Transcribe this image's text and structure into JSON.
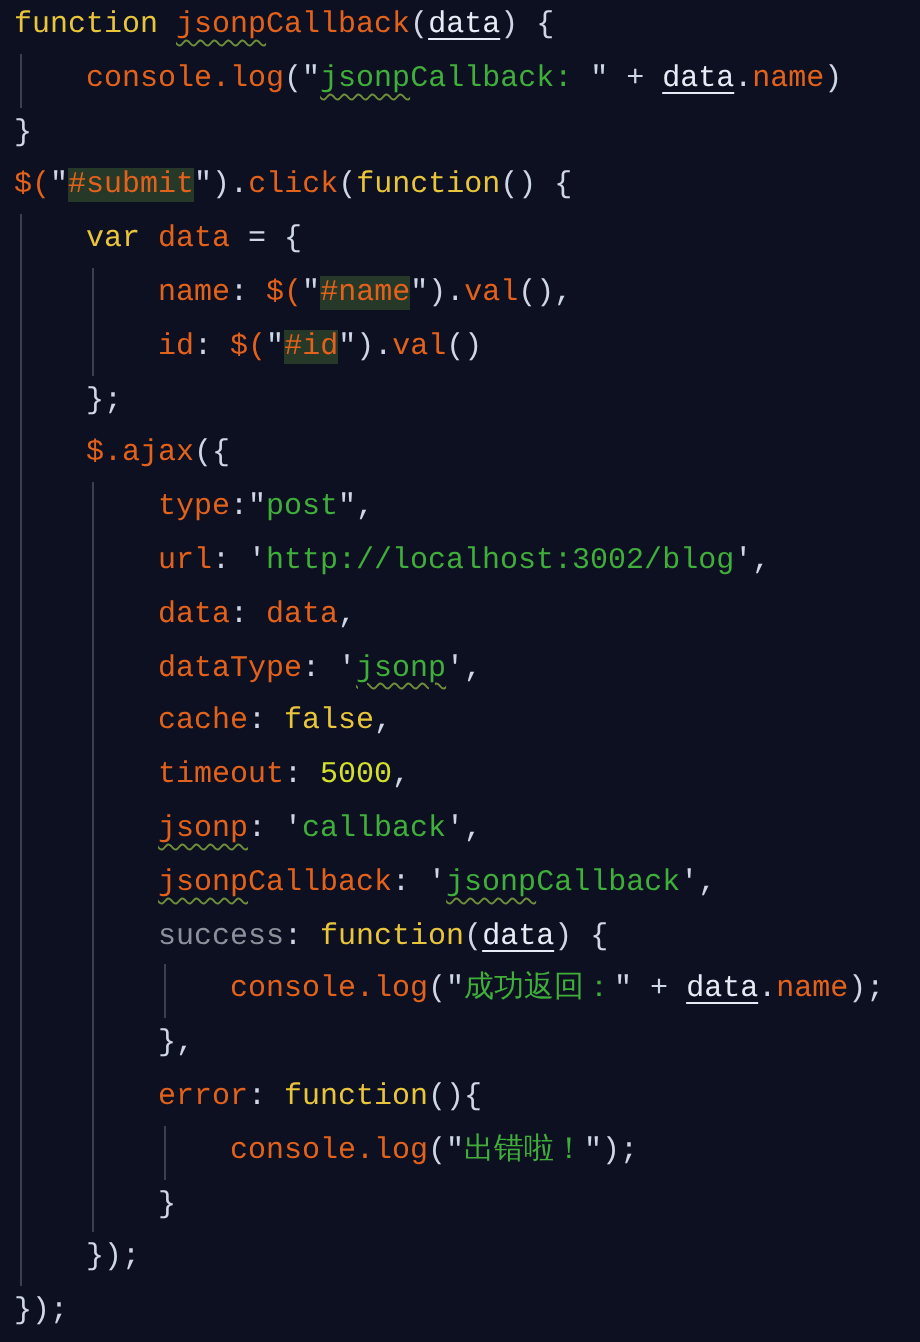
{
  "editor": {
    "lines": [
      {
        "tokens": [
          {
            "t": "function ",
            "kind": "keyword"
          },
          {
            "t": "jsonp",
            "kind": "name_squiggle"
          },
          {
            "t": "Callback",
            "kind": "name"
          },
          {
            "t": "(",
            "kind": "punct"
          },
          {
            "t": "data",
            "kind": "param"
          },
          {
            "t": ") {",
            "kind": "punct"
          }
        ],
        "children": [
          {
            "tokens": [
              {
                "t": "console.log",
                "kind": "name"
              },
              {
                "t": "(\"",
                "kind": "punct"
              },
              {
                "t": "jsonp",
                "kind": "string_squiggle"
              },
              {
                "t": "Callback: ",
                "kind": "string"
              },
              {
                "t": "\" + ",
                "kind": "punct"
              },
              {
                "t": "data",
                "kind": "param"
              },
              {
                "t": ".",
                "kind": "punct"
              },
              {
                "t": "name",
                "kind": "name"
              },
              {
                "t": ")",
                "kind": "punct"
              }
            ]
          }
        ]
      },
      {
        "tokens": [
          {
            "t": "}",
            "kind": "punct"
          }
        ]
      },
      {
        "tokens": [
          {
            "t": "$(",
            "kind": "name"
          },
          {
            "t": "\"",
            "kind": "punct"
          },
          {
            "t": "#submit",
            "kind": "name_match"
          },
          {
            "t": "\").",
            "kind": "punct"
          },
          {
            "t": "click",
            "kind": "name"
          },
          {
            "t": "(",
            "kind": "punct"
          },
          {
            "t": "function",
            "kind": "keyword"
          },
          {
            "t": "() {",
            "kind": "punct"
          }
        ],
        "children": [
          {
            "tokens": [
              {
                "t": "var ",
                "kind": "keyword"
              },
              {
                "t": "data",
                "kind": "name"
              },
              {
                "t": " = {",
                "kind": "punct"
              }
            ],
            "children": [
              {
                "tokens": [
                  {
                    "t": "name",
                    "kind": "name"
                  },
                  {
                    "t": ": ",
                    "kind": "punct"
                  },
                  {
                    "t": "$(",
                    "kind": "name"
                  },
                  {
                    "t": "\"",
                    "kind": "punct"
                  },
                  {
                    "t": "#name",
                    "kind": "name_match"
                  },
                  {
                    "t": "\").",
                    "kind": "punct"
                  },
                  {
                    "t": "val",
                    "kind": "name"
                  },
                  {
                    "t": "(),",
                    "kind": "punct"
                  }
                ]
              },
              {
                "tokens": [
                  {
                    "t": "id",
                    "kind": "name"
                  },
                  {
                    "t": ": ",
                    "kind": "punct"
                  },
                  {
                    "t": "$(",
                    "kind": "name"
                  },
                  {
                    "t": "\"",
                    "kind": "punct"
                  },
                  {
                    "t": "#id",
                    "kind": "name_match"
                  },
                  {
                    "t": "\").",
                    "kind": "punct"
                  },
                  {
                    "t": "val",
                    "kind": "name"
                  },
                  {
                    "t": "()",
                    "kind": "punct"
                  }
                ]
              }
            ]
          },
          {
            "tokens": [
              {
                "t": "};",
                "kind": "punct"
              }
            ]
          },
          {
            "tokens": [
              {
                "t": "$.ajax",
                "kind": "name"
              },
              {
                "t": "({",
                "kind": "punct"
              }
            ],
            "children": [
              {
                "tokens": [
                  {
                    "t": "type",
                    "kind": "name"
                  },
                  {
                    "t": ":\"",
                    "kind": "punct"
                  },
                  {
                    "t": "post",
                    "kind": "string"
                  },
                  {
                    "t": "\",",
                    "kind": "punct"
                  }
                ]
              },
              {
                "tokens": [
                  {
                    "t": "url",
                    "kind": "name"
                  },
                  {
                    "t": ": '",
                    "kind": "punct"
                  },
                  {
                    "t": "http://localhost:3002/blog",
                    "kind": "string"
                  },
                  {
                    "t": "',",
                    "kind": "punct"
                  }
                ]
              },
              {
                "tokens": [
                  {
                    "t": "data",
                    "kind": "name"
                  },
                  {
                    "t": ": ",
                    "kind": "punct"
                  },
                  {
                    "t": "data",
                    "kind": "name"
                  },
                  {
                    "t": ",",
                    "kind": "punct"
                  }
                ]
              },
              {
                "tokens": [
                  {
                    "t": "dataType",
                    "kind": "name"
                  },
                  {
                    "t": ": '",
                    "kind": "punct"
                  },
                  {
                    "t": "jsonp",
                    "kind": "string_squiggle"
                  },
                  {
                    "t": "',",
                    "kind": "punct"
                  }
                ]
              },
              {
                "tokens": [
                  {
                    "t": "cache",
                    "kind": "name"
                  },
                  {
                    "t": ": ",
                    "kind": "punct"
                  },
                  {
                    "t": "false",
                    "kind": "keyword"
                  },
                  {
                    "t": ",",
                    "kind": "punct"
                  }
                ]
              },
              {
                "tokens": [
                  {
                    "t": "timeout",
                    "kind": "name"
                  },
                  {
                    "t": ": ",
                    "kind": "punct"
                  },
                  {
                    "t": "5000",
                    "kind": "number"
                  },
                  {
                    "t": ",",
                    "kind": "punct"
                  }
                ]
              },
              {
                "tokens": [
                  {
                    "t": "jsonp",
                    "kind": "name_squiggle"
                  },
                  {
                    "t": ": '",
                    "kind": "punct"
                  },
                  {
                    "t": "callback",
                    "kind": "string"
                  },
                  {
                    "t": "',",
                    "kind": "punct"
                  }
                ]
              },
              {
                "tokens": [
                  {
                    "t": "jsonp",
                    "kind": "name_squiggle"
                  },
                  {
                    "t": "Callback",
                    "kind": "name"
                  },
                  {
                    "t": ": '",
                    "kind": "punct"
                  },
                  {
                    "t": "jsonp",
                    "kind": "string_squiggle"
                  },
                  {
                    "t": "Callback",
                    "kind": "string"
                  },
                  {
                    "t": "',",
                    "kind": "punct"
                  }
                ]
              },
              {
                "tokens": [
                  {
                    "t": "success",
                    "kind": "muted"
                  },
                  {
                    "t": ": ",
                    "kind": "punct"
                  },
                  {
                    "t": "function",
                    "kind": "keyword"
                  },
                  {
                    "t": "(",
                    "kind": "punct"
                  },
                  {
                    "t": "data",
                    "kind": "param"
                  },
                  {
                    "t": ") {",
                    "kind": "punct"
                  }
                ],
                "children": [
                  {
                    "tokens": [
                      {
                        "t": "console.log",
                        "kind": "name"
                      },
                      {
                        "t": "(\"",
                        "kind": "punct"
                      },
                      {
                        "t": "成功返回：",
                        "kind": "string"
                      },
                      {
                        "t": "\" + ",
                        "kind": "punct"
                      },
                      {
                        "t": "data",
                        "kind": "param"
                      },
                      {
                        "t": ".",
                        "kind": "punct"
                      },
                      {
                        "t": "name",
                        "kind": "name"
                      },
                      {
                        "t": ");",
                        "kind": "punct"
                      }
                    ]
                  }
                ]
              },
              {
                "tokens": [
                  {
                    "t": "},",
                    "kind": "punct"
                  }
                ]
              },
              {
                "tokens": [
                  {
                    "t": "error",
                    "kind": "name"
                  },
                  {
                    "t": ": ",
                    "kind": "punct"
                  },
                  {
                    "t": "function",
                    "kind": "keyword"
                  },
                  {
                    "t": "(){",
                    "kind": "punct"
                  }
                ],
                "children": [
                  {
                    "tokens": [
                      {
                        "t": "console.log",
                        "kind": "name"
                      },
                      {
                        "t": "(\"",
                        "kind": "punct"
                      },
                      {
                        "t": "出错啦！",
                        "kind": "string"
                      },
                      {
                        "t": "\");",
                        "kind": "punct"
                      }
                    ]
                  }
                ]
              },
              {
                "tokens": [
                  {
                    "t": "}",
                    "kind": "punct"
                  }
                ]
              }
            ]
          },
          {
            "tokens": [
              {
                "t": "});",
                "kind": "punct"
              }
            ]
          }
        ]
      },
      {
        "tokens": [
          {
            "t": "});",
            "kind": "punct"
          }
        ]
      }
    ]
  }
}
